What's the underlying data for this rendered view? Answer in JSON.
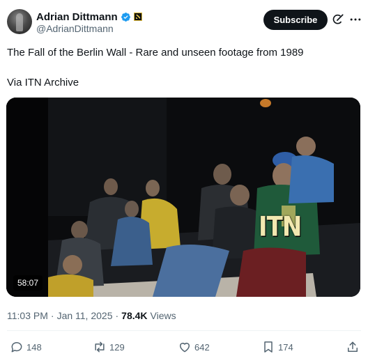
{
  "author": {
    "name": "Adrian Dittmann",
    "handle": "@AdrianDittmann",
    "verified_icon": "verified-badge-icon",
    "affiliation_icon": "affiliate-badge-icon"
  },
  "header": {
    "subscribe_label": "Subscribe",
    "grok_icon": "grok-icon",
    "more_icon": "more-icon"
  },
  "post": {
    "text_line1": "The Fall of the Berlin Wall - Rare and unseen footage from 1989",
    "text_line2": "Via ITN Archive"
  },
  "video": {
    "duration": "58:07",
    "watermark": "ITN"
  },
  "meta": {
    "time": "11:03 PM",
    "separator": "·",
    "date": "Jan 11, 2025",
    "views_count": "78.4K",
    "views_label": "Views"
  },
  "actions": {
    "replies": "148",
    "reposts": "129",
    "likes": "642",
    "bookmarks": "174"
  },
  "colors": {
    "text": "#0f1419",
    "secondary": "#536471",
    "verified": "#1d9bf0",
    "button": "#0f1419"
  }
}
